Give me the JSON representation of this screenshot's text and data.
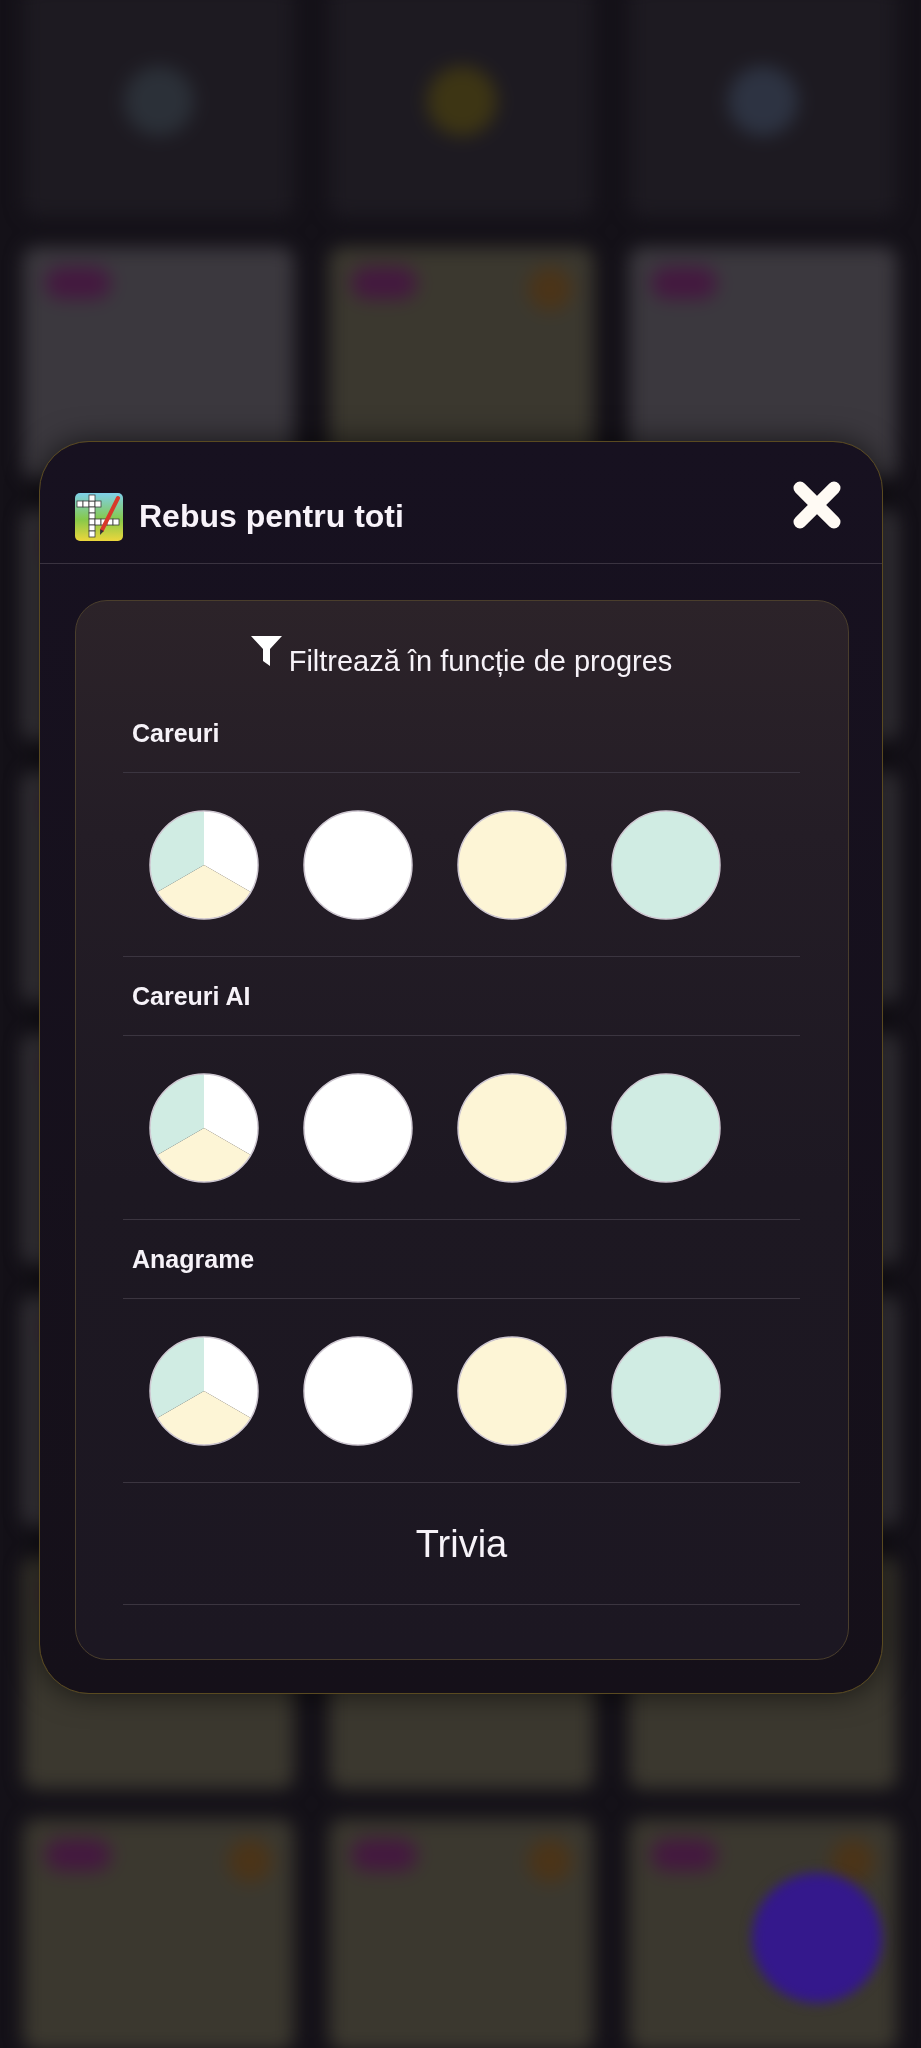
{
  "dialog": {
    "title": "Rebus pentru toti"
  },
  "filter_panel": {
    "heading": "Filtrează în funcție de progres",
    "sections": [
      {
        "kind": "filters",
        "title": "Careuri",
        "filters": [
          {
            "kind": "pie"
          },
          {
            "kind": "solid",
            "color": "#ffffff"
          },
          {
            "kind": "solid",
            "color": "#fdf5d6"
          },
          {
            "kind": "solid",
            "color": "#d0ece3"
          }
        ]
      },
      {
        "kind": "filters",
        "title": "Careuri AI",
        "filters": [
          {
            "kind": "pie"
          },
          {
            "kind": "solid",
            "color": "#ffffff"
          },
          {
            "kind": "solid",
            "color": "#fdf5d6"
          },
          {
            "kind": "solid",
            "color": "#d0ece3"
          }
        ]
      },
      {
        "kind": "filters",
        "title": "Anagrame",
        "filters": [
          {
            "kind": "pie"
          },
          {
            "kind": "solid",
            "color": "#ffffff"
          },
          {
            "kind": "solid",
            "color": "#fdf5d6"
          },
          {
            "kind": "solid",
            "color": "#d0ece3"
          }
        ]
      },
      {
        "kind": "plain",
        "title": "Trivia"
      }
    ]
  }
}
